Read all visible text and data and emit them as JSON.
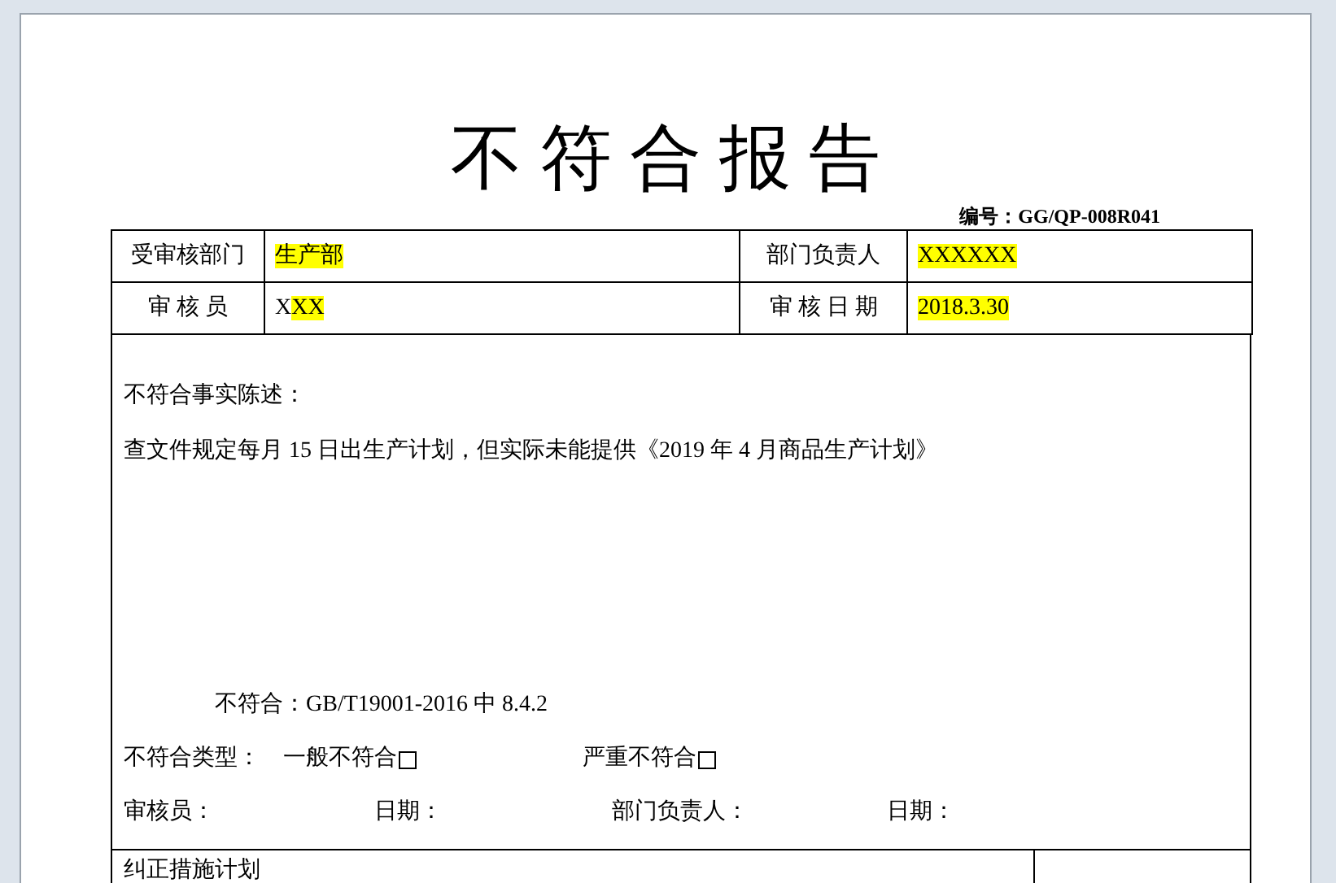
{
  "document": {
    "title": "不 符 合 报 告",
    "number": "编号：GG/QP-008R041",
    "header_rows": [
      {
        "label_1": "受审核部门",
        "value_1": [
          {
            "text": "生产部",
            "highlight": true
          }
        ],
        "label_2": "部门负责人",
        "value_2": [
          {
            "text": "XXXXXX",
            "highlight": true
          }
        ]
      },
      {
        "label_1": "审 核 员",
        "value_1": [
          {
            "text": "X",
            "highlight": false
          },
          {
            "text": "XX",
            "highlight": true
          }
        ],
        "label_2": "审 核 日 期",
        "value_2": [
          {
            "text": "2018.3.30",
            "highlight": true
          }
        ]
      }
    ],
    "facts_heading": "不符合事实陈述：",
    "facts_text": "查文件规定每月 15 日出生产计划，但实际未能提供《2019 年 4 月商品生产计划》",
    "nonconformity": "不符合：GB/T19001-2016 中 8.4.2",
    "type_label": "不符合类型：",
    "type_options": [
      {
        "label": "一般不符合",
        "checked": false
      },
      {
        "label": "严重不符合",
        "checked": false
      }
    ],
    "signatures": [
      "审核员：",
      "日期：",
      "部门负责人：",
      "日期："
    ],
    "next_section": "纠正措施计划"
  }
}
